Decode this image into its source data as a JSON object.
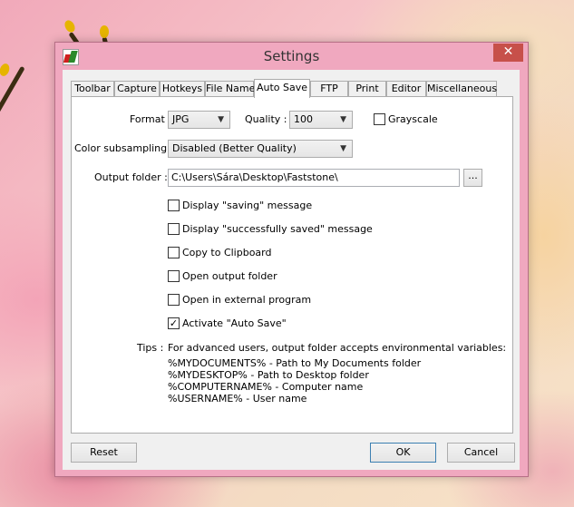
{
  "window": {
    "title": "Settings",
    "close_glyph": "✕"
  },
  "tabs": [
    {
      "label": "Toolbar"
    },
    {
      "label": "Capture"
    },
    {
      "label": "Hotkeys"
    },
    {
      "label": "File Name"
    },
    {
      "label": "Auto Save",
      "active": true
    },
    {
      "label": "FTP"
    },
    {
      "label": "Print"
    },
    {
      "label": "Editor"
    },
    {
      "label": "Miscellaneous"
    }
  ],
  "autosave": {
    "format_label": "Format :",
    "format_value": "JPG",
    "quality_label": "Quality :",
    "quality_value": "100",
    "grayscale_label": "Grayscale",
    "grayscale_checked": false,
    "subsampling_label": "Color subsampling :",
    "subsampling_value": "Disabled (Better Quality)",
    "output_label": "Output folder :",
    "output_value": "C:\\Users\\Sára\\Desktop\\Faststone\\",
    "browse_label": "...",
    "options": [
      {
        "label": "Display \"saving\" message",
        "checked": false
      },
      {
        "label": "Display \"successfully saved\" message",
        "checked": false
      },
      {
        "label": "Copy to Clipboard",
        "checked": false
      },
      {
        "label": "Open output folder",
        "checked": false
      },
      {
        "label": "Open in external program",
        "checked": false
      },
      {
        "label": "Activate \"Auto Save\"",
        "checked": true
      }
    ],
    "tips_label": "Tips :",
    "tips_intro": "For advanced users, output folder accepts environmental variables:",
    "tips_lines": [
      "%MYDOCUMENTS% - Path to My Documents folder",
      "%MYDESKTOP% - Path to Desktop folder",
      "%COMPUTERNAME% - Computer name",
      "%USERNAME% - User name"
    ]
  },
  "buttons": {
    "reset": "Reset",
    "ok": "OK",
    "cancel": "Cancel"
  },
  "icons": {
    "dropdown": "chevron-down-icon",
    "check": "checkmark-icon"
  },
  "colors": {
    "window_frame": "#f0a8bf",
    "close_button": "#c7504a",
    "default_button_border": "#3c7fb1"
  }
}
